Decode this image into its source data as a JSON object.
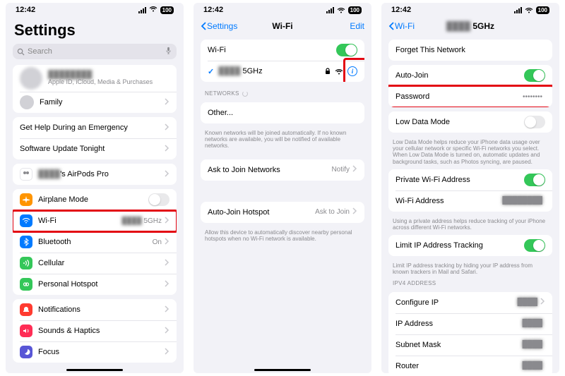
{
  "status": {
    "time": "12:42",
    "battery": "100"
  },
  "s1": {
    "title": "Settings",
    "search_ph": "Search",
    "profile_sub": "Apple ID, iCloud, Media & Purchases",
    "family": "Family",
    "emergency": "Get Help During an Emergency",
    "update": "Software Update Tonight",
    "airpods": "'s AirPods Pro",
    "airplane": "Airplane Mode",
    "wifi": "Wi-Fi",
    "wifi_val": "5GHz",
    "bt": "Bluetooth",
    "bt_val": "On",
    "cell": "Cellular",
    "hotspot": "Personal Hotspot",
    "notif": "Notifications",
    "sounds": "Sounds & Haptics",
    "focus": "Focus"
  },
  "s2": {
    "back": "Settings",
    "title": "Wi-Fi",
    "edit": "Edit",
    "wifi": "Wi-Fi",
    "net_name": "5GHz",
    "networks": "NETWORKS",
    "other": "Other...",
    "note1": "Known networks will be joined automatically. If no known networks are available, you will be notified of available networks.",
    "ask": "Ask to Join Networks",
    "ask_val": "Notify",
    "autojoin_h": "Auto-Join Hotspot",
    "autojoin_v": "Ask to Join",
    "note2": "Allow this device to automatically discover nearby personal hotspots when no Wi-Fi network is available."
  },
  "s3": {
    "back": "Wi-Fi",
    "title": "5GHz",
    "forget": "Forget This Network",
    "autojoin": "Auto-Join",
    "password": "Password",
    "pw_dots": "••••••••",
    "lowdata": "Low Data Mode",
    "note_low": "Low Data Mode helps reduce your iPhone data usage over your cellular network or specific Wi-Fi networks you select. When Low Data Mode is turned on, automatic updates and background tasks, such as Photos syncing, are paused.",
    "private": "Private Wi-Fi Address",
    "wifiaddr": "Wi-Fi Address",
    "note_priv": "Using a private address helps reduce tracking of your iPhone across different Wi-Fi networks.",
    "limitip": "Limit IP Address Tracking",
    "note_limit": "Limit IP address tracking by hiding your IP address from known trackers in Mail and Safari.",
    "ipv4": "IPV4 ADDRESS",
    "configip": "Configure IP",
    "ipaddr": "IP Address",
    "subnet": "Subnet Mask",
    "router": "Router"
  }
}
